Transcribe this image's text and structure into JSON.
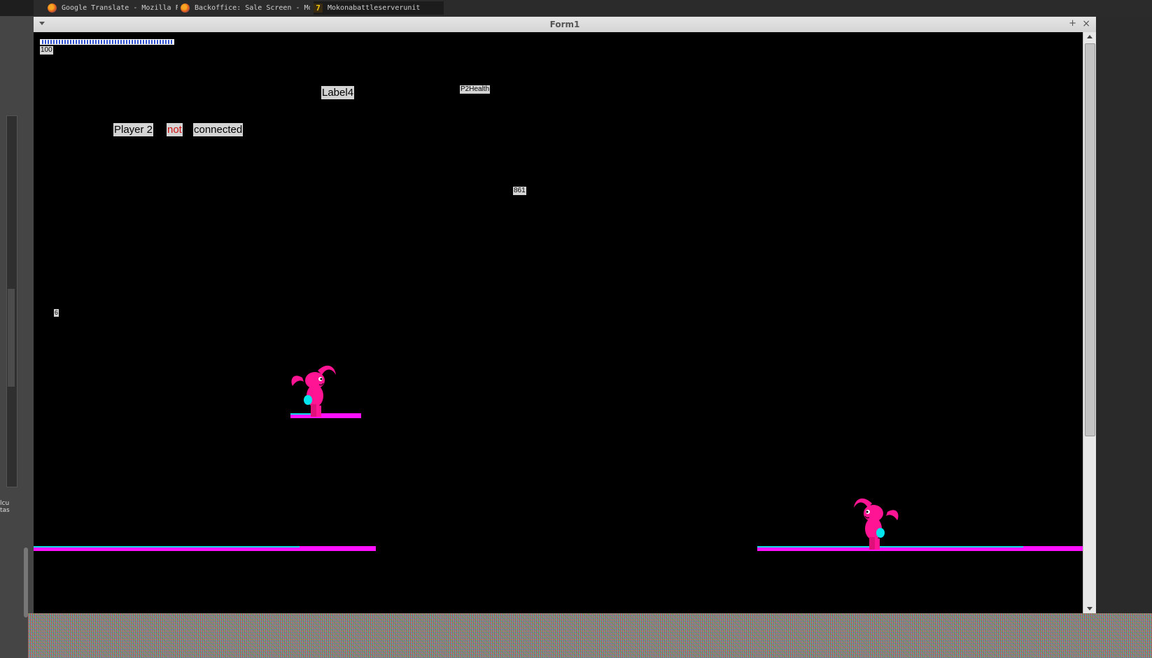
{
  "taskbar": {
    "tasks": [
      {
        "label": "Google Translate - Mozilla Firefox",
        "icon": "firefox-icon"
      },
      {
        "label": "Backoffice: Sale Screen - Mozilla…",
        "icon": "firefox-icon"
      },
      {
        "label": "Mokonabattleserverunit",
        "icon": "qt-creator-icon"
      }
    ]
  },
  "left_panel": {
    "text_line1": "lcu",
    "text_line2": "tas"
  },
  "window": {
    "title": "Form1",
    "pin_glyph": "+",
    "close_glyph": "×"
  },
  "game": {
    "health_bar_fraction": 1.0,
    "health_value": "100",
    "label4": "Label4",
    "p2health": "P2Health",
    "player2_label": "Player 2",
    "not_label": "not",
    "connected_label": "connected",
    "counter": "861",
    "small_value": "6"
  },
  "colors": {
    "platform": "#ff10ff",
    "platform_edge": "#00d8e8",
    "sprite_body": "#ff1493",
    "sprite_accent": "#00e5ee",
    "not_text": "#d01010"
  }
}
